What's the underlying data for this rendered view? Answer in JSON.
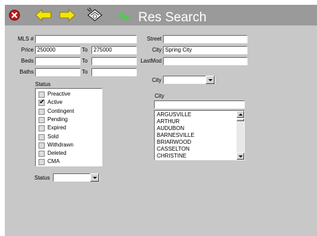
{
  "toolbar": {
    "icons": [
      "close-icon",
      "back-arrow-icon",
      "forward-arrow-icon",
      "clear-form-icon"
    ],
    "go_label": "Go",
    "title": "Res Search"
  },
  "form": {
    "mls": {
      "label": "MLS #",
      "value": ""
    },
    "price": {
      "label": "Price",
      "from": "250000",
      "to_label": "To",
      "to": "275000"
    },
    "beds": {
      "label": "Beds",
      "from": "",
      "to_label": "To",
      "to": ""
    },
    "baths": {
      "label": "Baths",
      "from": "",
      "to_label": "To",
      "to": ""
    },
    "street": {
      "label": "Street",
      "value": ""
    },
    "city": {
      "label": "City",
      "value": "Spring City"
    },
    "lastmod": {
      "label": "LastMod",
      "value": ""
    }
  },
  "status_list": {
    "label": "Status",
    "items": [
      {
        "label": "Preactive",
        "checked": false
      },
      {
        "label": "Active",
        "checked": true
      },
      {
        "label": "Contingent",
        "checked": false
      },
      {
        "label": "Pending",
        "checked": false
      },
      {
        "label": "Expired",
        "checked": false
      },
      {
        "label": "Sold",
        "checked": false
      },
      {
        "label": "Withdrawn",
        "checked": false
      },
      {
        "label": "Deleted",
        "checked": false
      },
      {
        "label": "CMA",
        "checked": false
      }
    ]
  },
  "status_dropdown": {
    "label": "Status",
    "value": ""
  },
  "city_dropdown": {
    "label": "City",
    "value": ""
  },
  "city_list": {
    "label": "City",
    "search_value": "",
    "items": [
      "ARGUSVILLE",
      "ARTHUR",
      "AUDUBON",
      "BARNESVILLE",
      "BRIARWOOD",
      "CASSELTON",
      "CHRISTINE"
    ]
  },
  "colors": {
    "titlebar": "#9a9a9a",
    "panel": "#c8c8c8",
    "go": "#33dd33",
    "arrows": "#f5e600",
    "close": "#c01818"
  }
}
